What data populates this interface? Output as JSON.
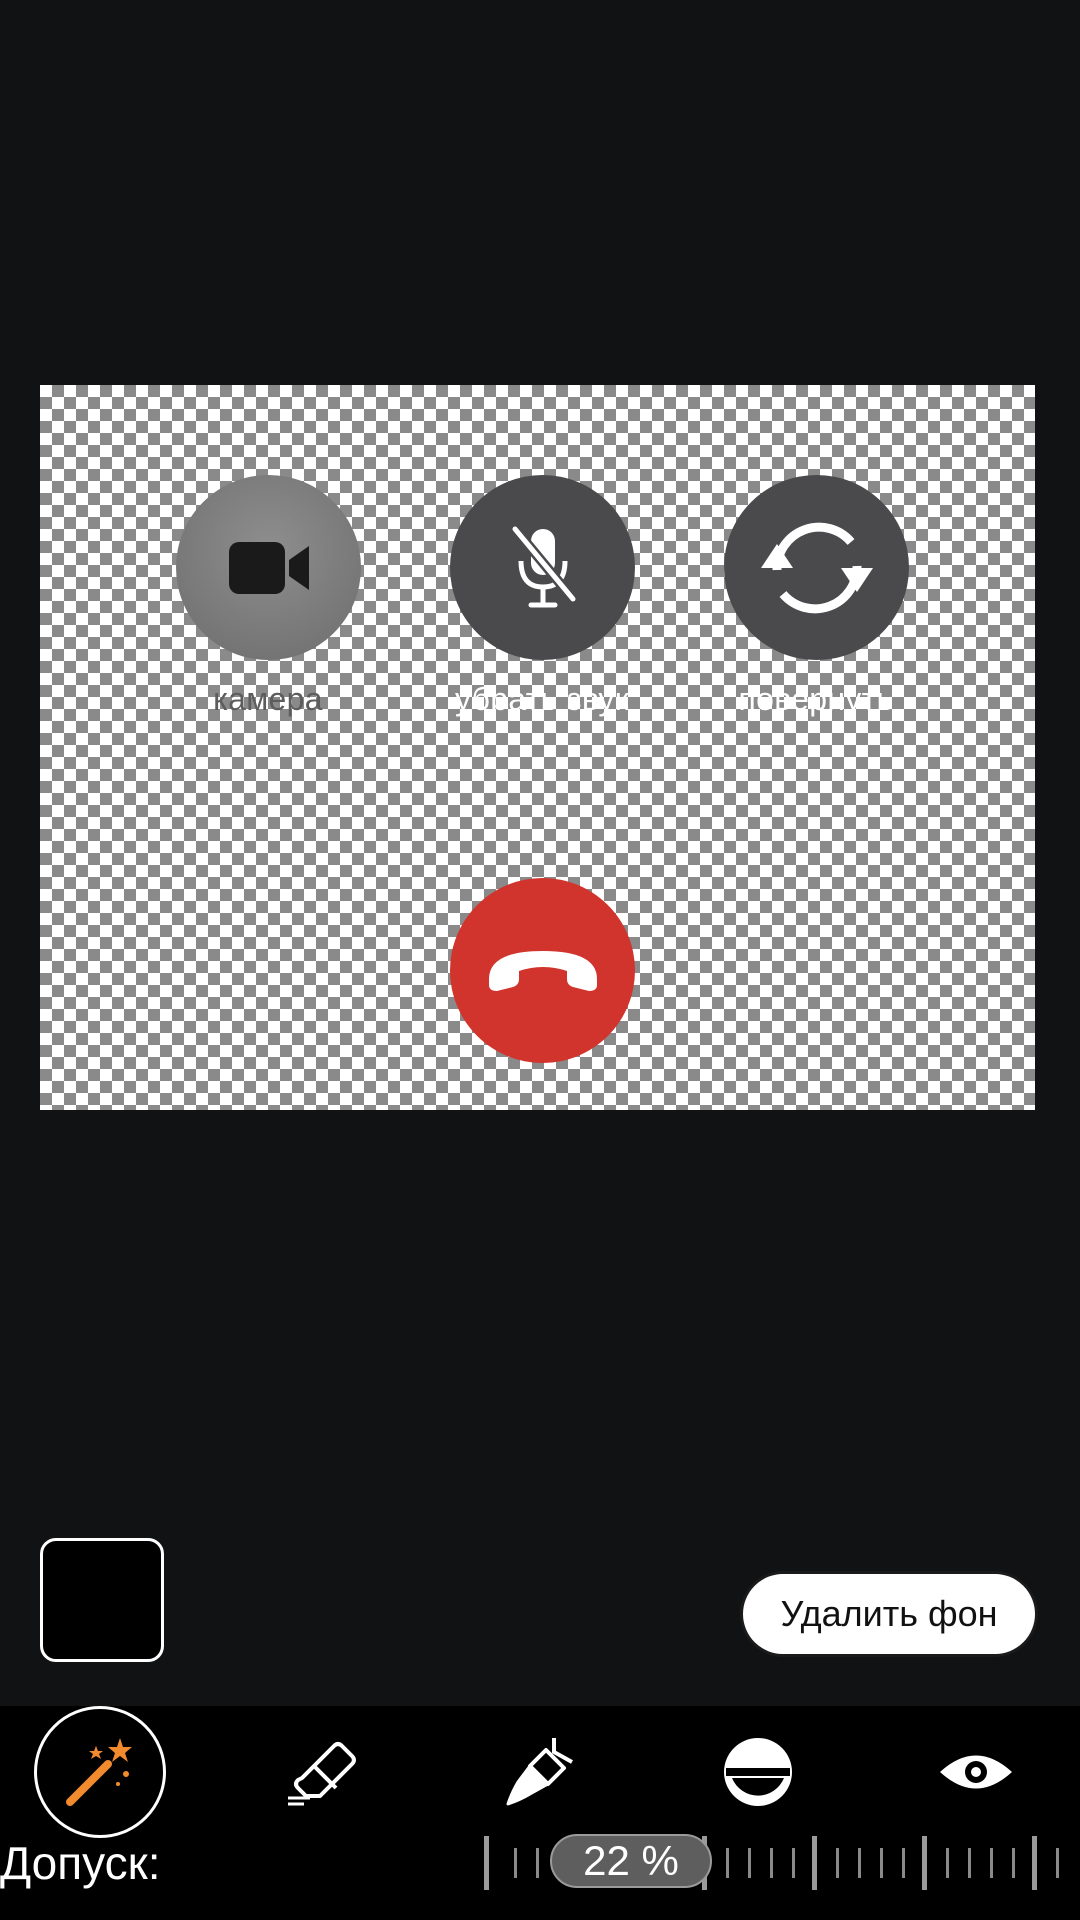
{
  "canvas": {
    "buttons": [
      {
        "label": "камера",
        "icon": "video-camera-icon"
      },
      {
        "label": "убрать звук",
        "icon": "mic-off-icon"
      },
      {
        "label": "повернуть",
        "icon": "rotate-icon"
      }
    ],
    "hangup_icon": "phone-hangup-icon",
    "colors": {
      "hangup": "#d0342c",
      "button_dark": "#4a4a4c",
      "button_gray": "#7d7d7d"
    }
  },
  "controls": {
    "color_swatch": "#000000",
    "remove_bg_label": "Удалить фон"
  },
  "toolbar": {
    "tools": [
      {
        "icon": "magic-wand-icon",
        "active": true
      },
      {
        "icon": "eraser-icon",
        "active": false
      },
      {
        "icon": "brush-icon",
        "active": false
      },
      {
        "icon": "half-circle-icon",
        "active": false
      },
      {
        "icon": "eye-icon",
        "active": false
      }
    ],
    "accent": "#f28a2e"
  },
  "tolerance": {
    "label": "Допуск:",
    "value_text": "22 %",
    "value": 22
  }
}
